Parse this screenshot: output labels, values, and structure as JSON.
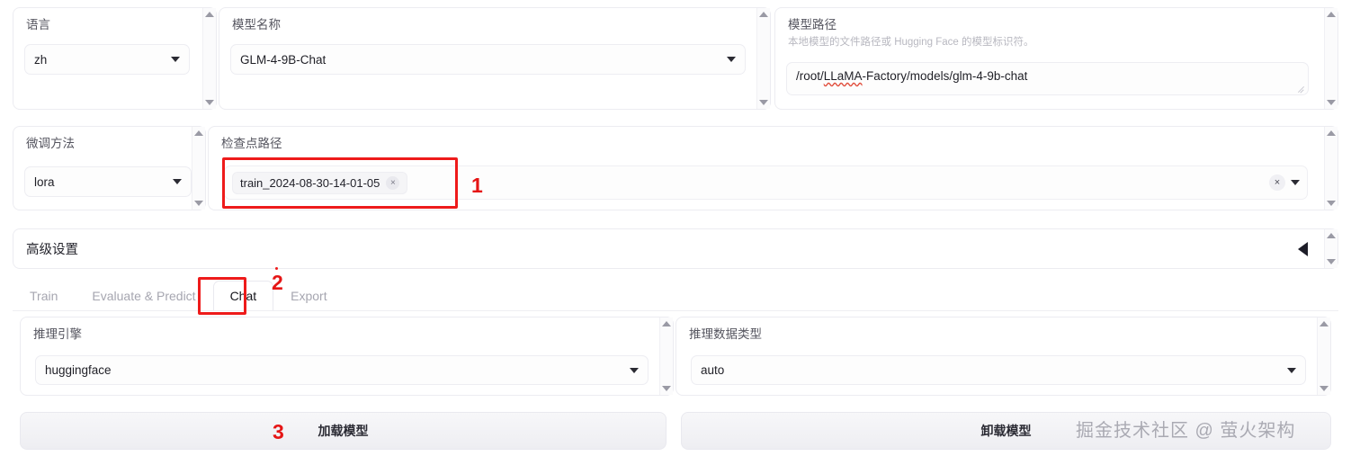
{
  "row1": {
    "language": {
      "label": "语言",
      "value": "zh"
    },
    "model_name": {
      "label": "模型名称",
      "value": "GLM-4-9B-Chat"
    },
    "model_path": {
      "label": "模型路径",
      "info": "本地模型的文件路径或 Hugging Face 的模型标识符。",
      "value_prefix": "/root/",
      "value_spell": "LLaMA",
      "value_suffix": "-Factory/models/glm-4-9b-chat"
    }
  },
  "row2": {
    "finetune_method": {
      "label": "微调方法",
      "value": "lora"
    },
    "checkpoint_path": {
      "label": "检查点路径",
      "tag": "train_2024-08-30-14-01-05",
      "tag_remove_icon": "×",
      "clear_icon": "×"
    }
  },
  "advanced": {
    "label": "高级设置"
  },
  "tabs": [
    {
      "label": "Train",
      "active": false
    },
    {
      "label": "Evaluate & Predict",
      "active": false
    },
    {
      "label": "Chat",
      "active": true
    },
    {
      "label": "Export",
      "active": false
    }
  ],
  "inference": {
    "engine": {
      "label": "推理引擎",
      "value": "huggingface"
    },
    "dtype": {
      "label": "推理数据类型",
      "value": "auto"
    }
  },
  "actions": {
    "load_model": "加载模型",
    "unload_model": "卸载模型"
  },
  "annotations": {
    "one": "1",
    "two": "2",
    "three": "3"
  },
  "watermark": "掘金技术社区 @ 萤火架构",
  "colors": {
    "annotation_red": "#ee1b1b",
    "panel_border": "#ececf1",
    "text_primary": "#1f1f26",
    "text_muted": "#a6a6b0"
  }
}
